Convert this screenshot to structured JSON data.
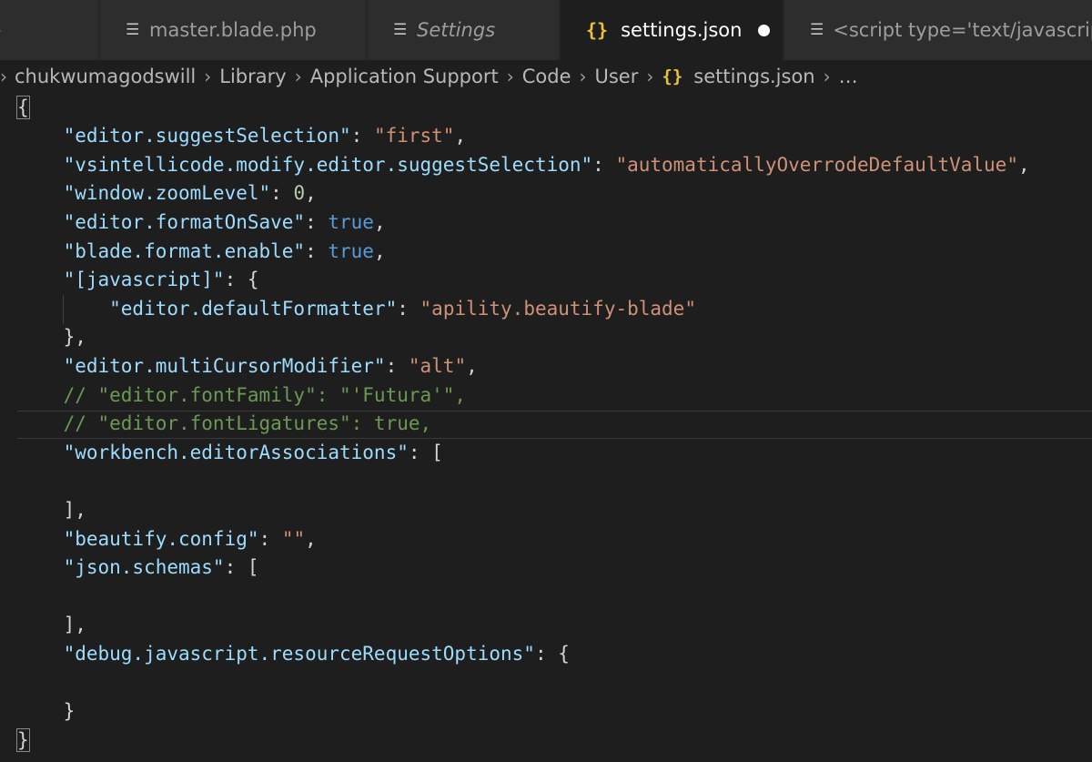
{
  "tabs": [
    {
      "label": "",
      "icon": "chevron-right-icon"
    },
    {
      "label": "master.blade.php",
      "icon": "lines-icon"
    },
    {
      "label": "Settings",
      "icon": "lines-icon"
    },
    {
      "label": "settings.json",
      "icon": "braces-icon",
      "active": true,
      "dirty": true
    },
    {
      "label": "<script type='text/javascript'>",
      "icon": "lines-icon"
    }
  ],
  "breadcrumb": {
    "items": [
      "chukwumagodswill",
      "Library",
      "Application Support",
      "Code",
      "User"
    ],
    "file_label": "settings.json",
    "more_label": "…"
  },
  "code": {
    "lines": [
      [
        {
          "t": "{",
          "c": "p",
          "match": true
        }
      ],
      [
        {
          "t": "    \"editor.suggestSelection\"",
          "c": "k"
        },
        {
          "t": ": ",
          "c": "p"
        },
        {
          "t": "\"first\"",
          "c": "s"
        },
        {
          "t": ",",
          "c": "p"
        }
      ],
      [
        {
          "t": "    \"vsintellicode.modify.editor.suggestSelection\"",
          "c": "k"
        },
        {
          "t": ": ",
          "c": "p"
        },
        {
          "t": "\"automaticallyOverrodeDefaultValue\"",
          "c": "s"
        },
        {
          "t": ",",
          "c": "p"
        }
      ],
      [
        {
          "t": "    \"window.zoomLevel\"",
          "c": "k"
        },
        {
          "t": ": ",
          "c": "p"
        },
        {
          "t": "0",
          "c": "n"
        },
        {
          "t": ",",
          "c": "p"
        }
      ],
      [
        {
          "t": "    \"editor.formatOnSave\"",
          "c": "k"
        },
        {
          "t": ": ",
          "c": "p"
        },
        {
          "t": "true",
          "c": "b"
        },
        {
          "t": ",",
          "c": "p"
        }
      ],
      [
        {
          "t": "    \"blade.format.enable\"",
          "c": "k"
        },
        {
          "t": ": ",
          "c": "p"
        },
        {
          "t": "true",
          "c": "b"
        },
        {
          "t": ",",
          "c": "p"
        }
      ],
      [
        {
          "t": "    \"[javascript]\"",
          "c": "k"
        },
        {
          "t": ": {",
          "c": "p"
        }
      ],
      [
        {
          "t": "        \"editor.defaultFormatter\"",
          "c": "k"
        },
        {
          "t": ": ",
          "c": "p"
        },
        {
          "t": "\"apility.beautify-blade\"",
          "c": "s"
        }
      ],
      [
        {
          "t": "    },",
          "c": "p"
        }
      ],
      [
        {
          "t": "    \"editor.multiCursorModifier\"",
          "c": "k"
        },
        {
          "t": ": ",
          "c": "p"
        },
        {
          "t": "\"alt\"",
          "c": "s"
        },
        {
          "t": ",",
          "c": "p"
        }
      ],
      [
        {
          "t": "    // \"editor.fontFamily\": \"'Futura'\",",
          "c": "c"
        }
      ],
      [
        {
          "t": "    // \"editor.fontLigatures\": true,",
          "c": "c"
        }
      ],
      [
        {
          "t": "    \"workbench.editorAssociations\"",
          "c": "k"
        },
        {
          "t": ": [",
          "c": "p"
        }
      ],
      [],
      [
        {
          "t": "    ],",
          "c": "p"
        }
      ],
      [
        {
          "t": "    \"beautify.config\"",
          "c": "k"
        },
        {
          "t": ": ",
          "c": "p"
        },
        {
          "t": "\"\"",
          "c": "s"
        },
        {
          "t": ",",
          "c": "p"
        }
      ],
      [
        {
          "t": "    \"json.schemas\"",
          "c": "k"
        },
        {
          "t": ": [",
          "c": "p"
        }
      ],
      [],
      [
        {
          "t": "    ],",
          "c": "p"
        }
      ],
      [
        {
          "t": "    \"debug.javascript.resourceRequestOptions\"",
          "c": "k"
        },
        {
          "t": ": {",
          "c": "p"
        }
      ],
      [],
      [
        {
          "t": "    }",
          "c": "p"
        }
      ],
      [
        {
          "t": "}",
          "c": "p",
          "match": true
        }
      ]
    ]
  },
  "colors": {
    "editor_background": "#1e1e1e",
    "tab_background": "#2d2d2d",
    "property_key": "#9cdcfe",
    "string": "#ce9178",
    "number": "#b5cea8",
    "boolean": "#569cd6",
    "comment": "#6a9955",
    "json_braces_icon": "#e8c23f"
  }
}
